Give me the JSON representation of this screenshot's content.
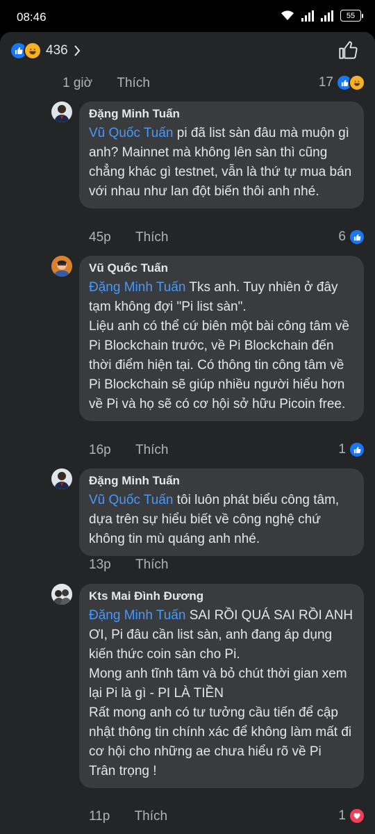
{
  "status_bar": {
    "time": "08:46",
    "battery": "55"
  },
  "reactions": {
    "total": "436"
  },
  "parent_meta": {
    "time": "1 giờ",
    "like_label": "Thích",
    "reaction_count": "17"
  },
  "comments": [
    {
      "author": "Đặng Minh Tuấn",
      "mention": "Vũ Quốc Tuấn",
      "text": " pi đã list sàn đâu mà muộn gì anh? Mainnet mà không lên sàn thì cũng chẳng khác gì testnet, vẫn là thứ tự mua bán với nhau như lan đột biến thôi anh nhé.",
      "time": "45p",
      "like_label": "Thích",
      "reaction_count": "6"
    },
    {
      "author": "Vũ Quốc Tuấn",
      "mention": "Đặng Minh Tuấn",
      "text": " Tks anh. Tuy nhiên ở đây tạm không đợi \"Pi list sàn\".\nLiệu anh có thể cứ biên một bài công tâm về Pi Blockchain trước, về Pi Blockchain đến thời điểm hiện tại. Có thông tin công tâm về Pi Blockchain sẽ giúp nhiều người hiểu hơn về Pi và họ sẽ có cơ hội sở hữu Picoin free.",
      "time": "16p",
      "like_label": "Thích",
      "reaction_count": "1"
    },
    {
      "author": "Đặng Minh Tuấn",
      "mention": "Vũ Quốc Tuấn",
      "text": " tôi luôn phát biểu công tâm, dựa trên sự hiểu biết về công nghệ chứ không tin mù quáng anh nhé.",
      "time": "13p",
      "like_label": "Thích",
      "reaction_count": ""
    },
    {
      "author": "Kts Mai Đình Đương",
      "mention": "Đặng Minh Tuấn",
      "text": " SAI RỒI QUÁ SAI RỒI ANH ƠI, Pi đâu cần list sàn, anh đang áp dụng kiến thức coin sàn cho Pi.\nMong anh tĩnh tâm và bỏ chút thời gian xem lại Pi là gì - PI LÀ TIỀN\nRất mong anh có tư tưởng cầu tiến để cập nhật thông tin chính xác để không làm mất đi cơ hội cho những ae chưa hiểu rõ về Pi\nTrân trọng !",
      "time": "11p",
      "like_label": "Thích",
      "reaction_count": "1"
    }
  ],
  "colors": {
    "like": "#1877f2",
    "haha": "#f7b125",
    "love": "#f33e58",
    "mention": "#4599ff"
  }
}
